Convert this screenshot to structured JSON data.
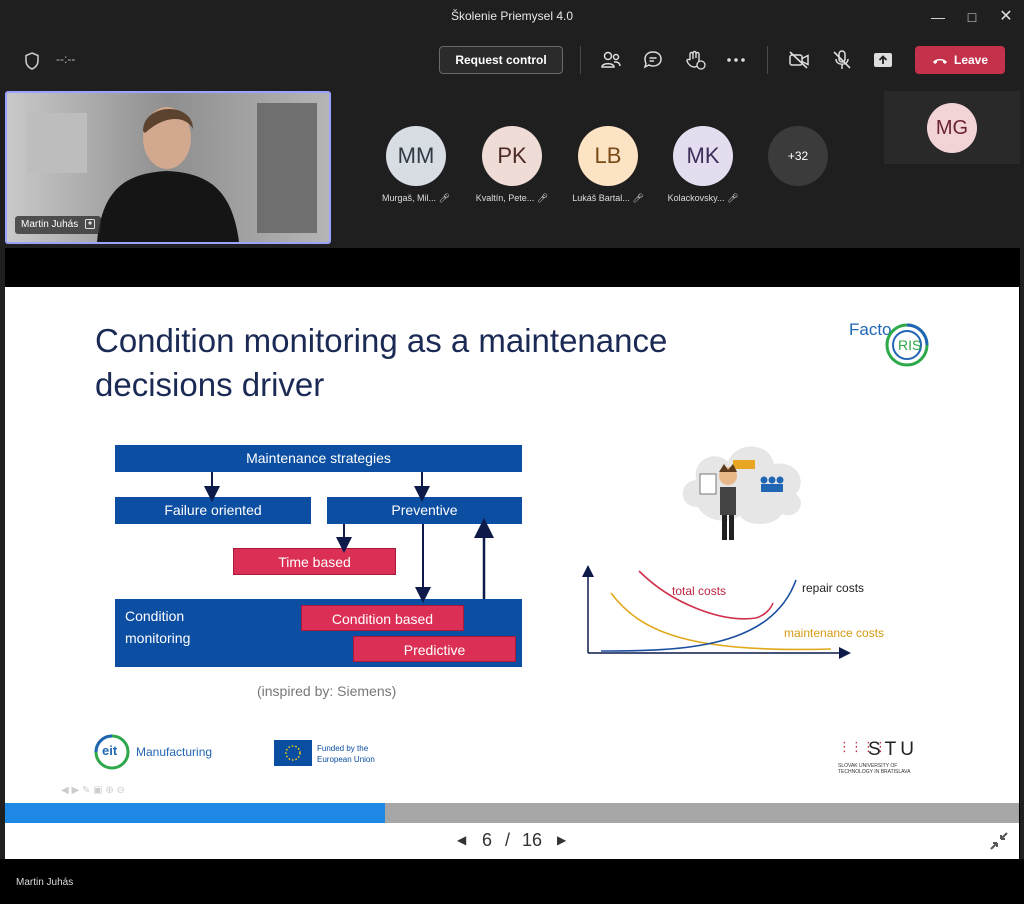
{
  "window": {
    "title": "Školenie Priemysel 4.0"
  },
  "toolbar": {
    "timer": "--:--",
    "request_control": "Request control",
    "leave": "Leave"
  },
  "self_video": {
    "name": "Martin Juhás"
  },
  "participants": [
    {
      "initials": "MM",
      "name": "Murgaš, Mil...",
      "bg": "#d8dde3",
      "fg": "#2f3a45"
    },
    {
      "initials": "PK",
      "name": "Kvaltín, Pete...",
      "bg": "#f0dcd6",
      "fg": "#4a2a22"
    },
    {
      "initials": "LB",
      "name": "Lukáš Bartal...",
      "bg": "#fbe3c4",
      "fg": "#7a4a16"
    },
    {
      "initials": "MK",
      "name": "Kolackovsky...",
      "bg": "#e4dcef",
      "fg": "#3e2f5a"
    }
  ],
  "overflow": {
    "label": "+32"
  },
  "side_avatar": {
    "initials": "MG",
    "bg": "#f2d4d7",
    "fg": "#6b2230"
  },
  "slide": {
    "title_line1": "Condition monitoring as a maintenance",
    "title_line2": "decisions driver",
    "logo_text": "Facto",
    "logo_ring": "RIS",
    "diagram": {
      "maintenance_strategies": "Maintenance strategies",
      "failure_oriented": "Failure oriented",
      "preventive": "Preventive",
      "time_based": "Time based",
      "condition_monitoring_1": "Condition",
      "condition_monitoring_2": "monitoring",
      "condition_based": "Condition based",
      "predictive": "Predictive",
      "source": "(inspired by: Siemens)"
    },
    "cost_chart": {
      "total_costs": "total costs",
      "repair_costs": "repair costs",
      "maintenance_costs": "maintenance costs"
    },
    "footer": {
      "eit": "eit",
      "manufacturing": "Manufacturing",
      "eu_line1": "Funded by the",
      "eu_line2": "European Union",
      "stu": "STU",
      "stu_sub1": "SLOVAK UNIVERSITY OF",
      "stu_sub2": "TECHNOLOGY IN BRATISLAVA"
    }
  },
  "progress": {
    "fraction": 0.375
  },
  "pager": {
    "current": "6",
    "separator": "/",
    "total": "16"
  },
  "footer": {
    "presenter": "Martin Juhás"
  },
  "colors": {
    "leave": "#c4314b",
    "slide_blue": "#0b4ea2",
    "slide_red": "#dc2f55",
    "progress": "#1e88e5",
    "selected_border": "#9ea2ff"
  }
}
